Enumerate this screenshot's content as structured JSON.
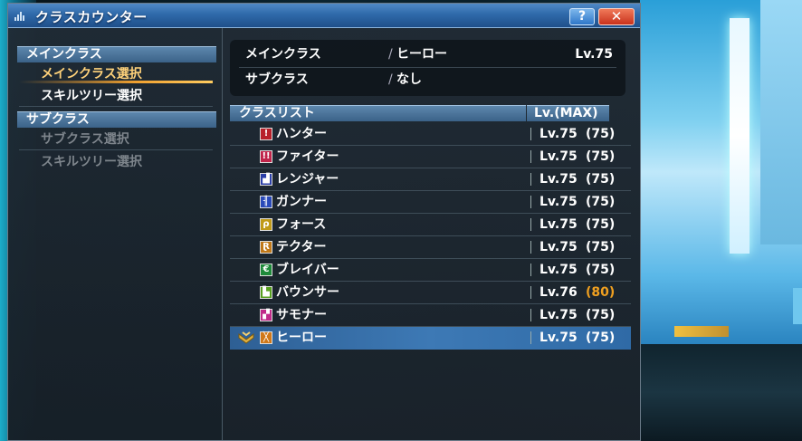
{
  "window": {
    "title": "クラスカウンター",
    "help_label": "?",
    "close_label": "✕"
  },
  "sidebar": {
    "main_header": "メインクラス",
    "main_items": [
      {
        "label": "メインクラス選択",
        "state": "selected"
      },
      {
        "label": "スキルツリー選択",
        "state": "normal"
      }
    ],
    "sub_header": "サブクラス",
    "sub_items": [
      {
        "label": "サブクラス選択",
        "state": "disabled"
      },
      {
        "label": "スキルツリー選択",
        "state": "disabled"
      }
    ]
  },
  "summary": {
    "main_label": "メインクラス",
    "main_value": "ヒーロー",
    "main_level": "Lv.75",
    "sub_label": "サブクラス",
    "sub_value": "なし",
    "separator": "/"
  },
  "class_list": {
    "header_name": "クラスリスト",
    "header_level": "Lv.(MAX)",
    "rows": [
      {
        "name": "ハンター",
        "level": "Lv.75",
        "max": "(75)",
        "icon": "hunter-icon",
        "color": "#b8202a",
        "glyph": "!"
      },
      {
        "name": "ファイター",
        "level": "Lv.75",
        "max": "(75)",
        "icon": "fighter-icon",
        "color": "#c0244a",
        "glyph": "!!"
      },
      {
        "name": "レンジャー",
        "level": "Lv.75",
        "max": "(75)",
        "icon": "ranger-icon",
        "color": "#2a3ea8",
        "glyph": "▟"
      },
      {
        "name": "ガンナー",
        "level": "Lv.75",
        "max": "(75)",
        "icon": "gunner-icon",
        "color": "#2a4ab8",
        "glyph": "╢"
      },
      {
        "name": "フォース",
        "level": "Lv.75",
        "max": "(75)",
        "icon": "force-icon",
        "color": "#c09a18",
        "glyph": "ρ"
      },
      {
        "name": "テクター",
        "level": "Lv.75",
        "max": "(75)",
        "icon": "techer-icon",
        "color": "#c07818",
        "glyph": "Ɽ"
      },
      {
        "name": "ブレイバー",
        "level": "Lv.75",
        "max": "(75)",
        "icon": "braver-icon",
        "color": "#1e8a3a",
        "glyph": "€"
      },
      {
        "name": "バウンサー",
        "level": "Lv.76",
        "max": "(80)",
        "icon": "bouncer-icon",
        "color": "#58a020",
        "glyph": "▙",
        "highlight": true
      },
      {
        "name": "サモナー",
        "level": "Lv.75",
        "max": "(75)",
        "icon": "summoner-icon",
        "color": "#c02a88",
        "glyph": "▞"
      },
      {
        "name": "ヒーロー",
        "level": "Lv.75",
        "max": "(75)",
        "icon": "hero-icon",
        "color": "#d07818",
        "glyph": "╳",
        "active": true
      }
    ]
  },
  "colors": {
    "selected_text": "#ffd27a",
    "max_highlight": "#f0a020",
    "title_bar": "#2f6aaa",
    "close_button": "#c8321c"
  }
}
